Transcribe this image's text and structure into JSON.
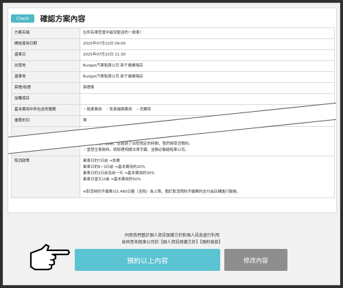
{
  "header": {
    "badge": "Check",
    "title": "確認方案內容"
  },
  "rows": [
    {
      "key": "方案名稱",
      "values": [
        "在所有車型當中最受歡迎的一款車!"
      ]
    },
    {
      "key": "開始使用日期",
      "values": [
        "2025年07月10日 09:00"
      ]
    },
    {
      "key": "還車日",
      "values": [
        "2025年07月10日 11:30"
      ]
    },
    {
      "key": "出發地",
      "values": [
        "Budget汽車租賃公司 新千歲機場店"
      ]
    },
    {
      "key": "還車地",
      "values": [
        "Budget汽車租賃公司 新千歲機場店"
      ]
    },
    {
      "key": "禁煙/吸煙",
      "values": [
        "禁煙車"
      ]
    },
    {
      "key": "加購項目",
      "values": [
        ""
      ]
    },
    {
      "key": "基本費用中所包含的服務",
      "values": [
        "・租車費用　・免責補償費用　・消費稅"
      ]
    },
    {
      "key": "優惠折扣",
      "values": [
        "無"
      ]
    },
    {
      "key": "",
      "values": [
        "・不可直接指定車型以外的車輛。",
        "・租車時間延長需由租車公司進行判斷。",
        "・若沒有任何聯絡，並超過了出發預定的時間，我們將取消預約。",
        "・當發生事故時，請辦理相關法律手續，並務必聯絡租車公司。"
      ]
    },
    {
      "key": "取消政策",
      "values": [
        "乘車日的7日前 ⇒免費",
        "乘車日的6~3日前 ⇒基本費用的20%",
        "乘車日的2日前及前一天 ⇒基本費用的30%",
        "乘車日當天以後 ⇒基本費用的50%",
        "",
        "※取消時的手續費以5,480日圓（含稅）為上限。關於取消預約手續費的支付由店舖進行聯絡。"
      ]
    }
  ],
  "extra_text": "・基本費用以外的額外項目，如有需要請在現場另行支付。詳情請參閱條款。",
  "agreement": {
    "line1": "同意我們基於個人資訊保護方針對個人訊息進行利用",
    "line2": "並同意各租車公司的【個人資訊保護方針】【預約條款】"
  },
  "buttons": {
    "reserve": "預約以上內容",
    "modify": "修改內容"
  },
  "colors": {
    "accent": "#5bc3d2",
    "secondary": "#8e8e8e"
  }
}
